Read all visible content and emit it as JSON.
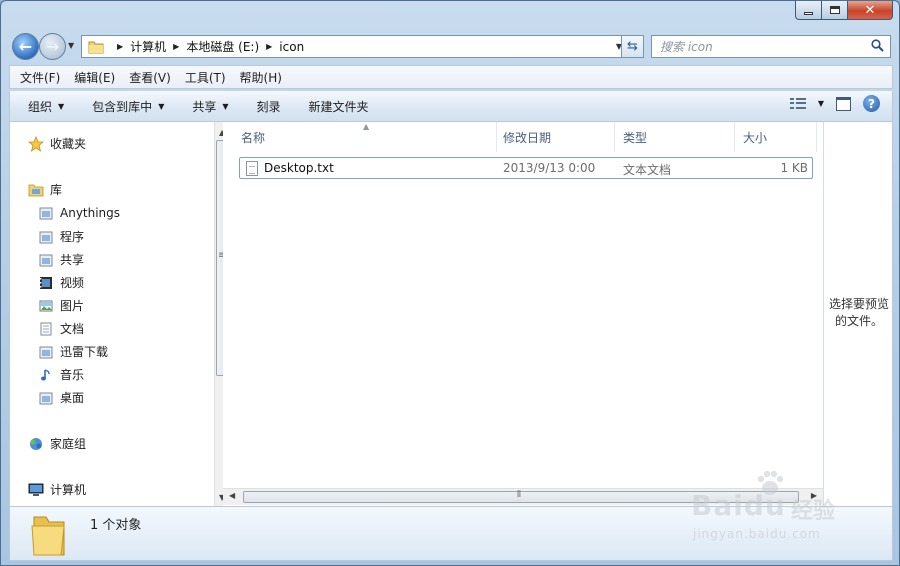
{
  "address": {
    "crumbs": [
      "计算机",
      "本地磁盘 (E:)",
      "icon"
    ]
  },
  "search": {
    "placeholder": "搜索 icon"
  },
  "menubar": {
    "items": [
      "文件(F)",
      "编辑(E)",
      "查看(V)",
      "工具(T)",
      "帮助(H)"
    ]
  },
  "toolbar": {
    "organize": "组织",
    "include_in_library": "包含到库中",
    "share": "共享",
    "burn": "刻录",
    "new_folder": "新建文件夹"
  },
  "navpane": {
    "favorites": "收藏夹",
    "libraries": "库",
    "library_items": [
      "Anythings",
      "程序",
      "共享",
      "视频",
      "图片",
      "文档",
      "迅雷下载",
      "音乐",
      "桌面"
    ],
    "homegroup": "家庭组",
    "computer": "计算机"
  },
  "columns": {
    "name": "名称",
    "date_modified": "修改日期",
    "type": "类型",
    "size": "大小"
  },
  "files": [
    {
      "name": "Desktop.txt",
      "date_modified": "2013/9/13 0:00",
      "type": "文本文档",
      "size": "1 KB"
    }
  ],
  "preview": {
    "message_line1": "选择要预览",
    "message_line2": "的文件。"
  },
  "status": {
    "count_text": "1 个对象"
  },
  "watermark": {
    "brand": "Bai",
    "brand2": "du",
    "cn": "经验",
    "url": "jingyan.baidu.com"
  },
  "colors": {
    "accent": "#2f6fbf",
    "selection_border": "#7da2ce"
  }
}
